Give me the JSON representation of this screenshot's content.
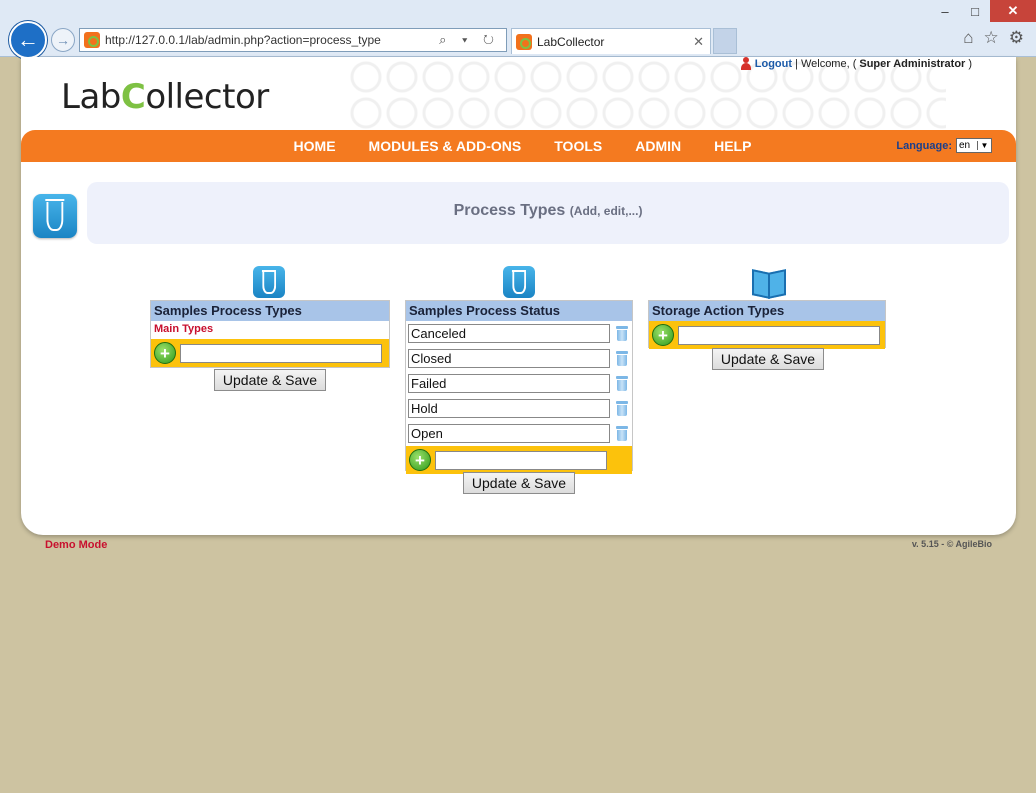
{
  "browser": {
    "url": "http://127.0.0.1/lab/admin.php?action=process_type",
    "tab_title": "LabCollector",
    "addr_icons": "⌕ ▾ ↻",
    "minimize": "–",
    "maximize": "□",
    "close": "✕",
    "home": "⌂",
    "favorites": "☆",
    "settings": "⚙"
  },
  "header": {
    "logo_pre": "Lab",
    "logo_c": "C",
    "logo_post": "ollector",
    "logout": "Logout",
    "welcome": "| Welcome, (",
    "user": "Super Administrator",
    "close_paren": ")"
  },
  "nav": {
    "items": [
      "HOME",
      "MODULES & ADD-ONS",
      "TOOLS",
      "ADMIN",
      "HELP"
    ],
    "language_label": "Language:",
    "language_value": "en"
  },
  "title": {
    "main": "Process Types",
    "sub": "(Add, edit,...)"
  },
  "panels": {
    "process_types": {
      "header": "Samples Process Types",
      "main_types": "Main Types",
      "new_value": "",
      "button": "Update & Save"
    },
    "process_status": {
      "header": "Samples Process Status",
      "items": [
        "Canceled",
        "Closed",
        "Failed",
        "Hold",
        "Open"
      ],
      "new_value": "",
      "button": "Update & Save"
    },
    "storage_action": {
      "header": "Storage Action Types",
      "new_value": "",
      "button": "Update & Save"
    }
  },
  "footer": {
    "mode": "Demo Mode",
    "version": "v. 5.15 - © AgileBio"
  },
  "colors": {
    "nav_orange": "#f47a20",
    "panel_header": "#a8c4e8",
    "add_row": "#fcc20c",
    "page_bg": "#cdc3a1"
  }
}
